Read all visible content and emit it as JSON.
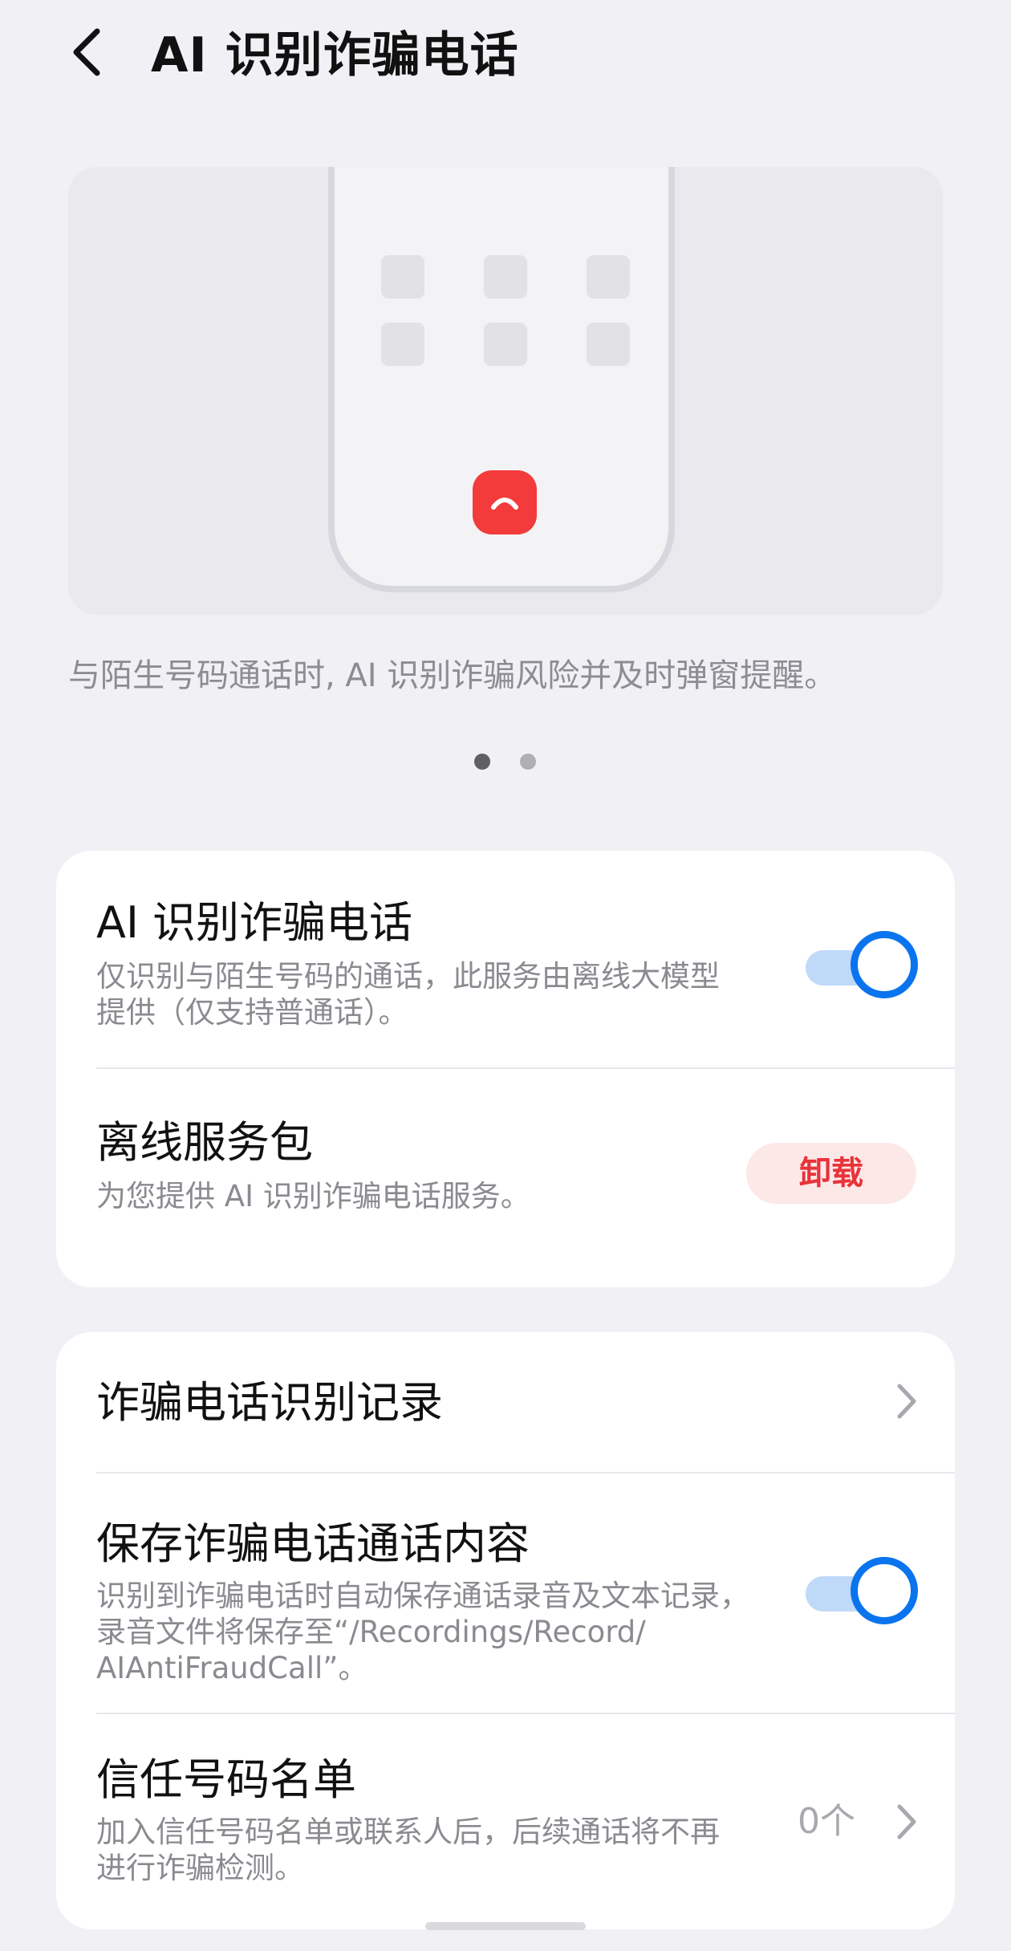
{
  "header": {
    "title": "AI 识别诈骗电话",
    "back_icon": "back-arrow-icon"
  },
  "carousel": {
    "caption": "与陌生号码通话时, AI 识别诈骗风险并及时弹窗提醒。",
    "page_count": 2,
    "active_page": 1
  },
  "card1": {
    "ai_detect": {
      "title": "AI 识别诈骗电话",
      "desc_line1": "仅识别与陌生号码的通话，此服务由离线大模型",
      "desc_line2": "提供（仅支持普通话）。",
      "enabled": true
    },
    "offline_pack": {
      "title": "离线服务包",
      "desc": "为您提供 AI 识别诈骗电话服务。",
      "button_label": "卸载"
    }
  },
  "card2": {
    "records": {
      "title": "诈骗电话识别记录"
    },
    "save_content": {
      "title": "保存诈骗电话通话内容",
      "desc_line1": "识别到诈骗电话时自动保存通话录音及文本记录，",
      "desc_line2": "录音文件将保存至“/Recordings/Record/",
      "desc_line3": "AIAntiFraudCall”。",
      "enabled": true
    },
    "trust_list": {
      "title": "信任号码名单",
      "desc_line1": "加入信任号码名单或联系人后，后续通话将不再",
      "desc_line2": "进行诈骗检测。",
      "count": "0个"
    }
  },
  "colors": {
    "accent": "#0A74EE",
    "danger": "#E8333A",
    "background": "#F1F1F5"
  }
}
